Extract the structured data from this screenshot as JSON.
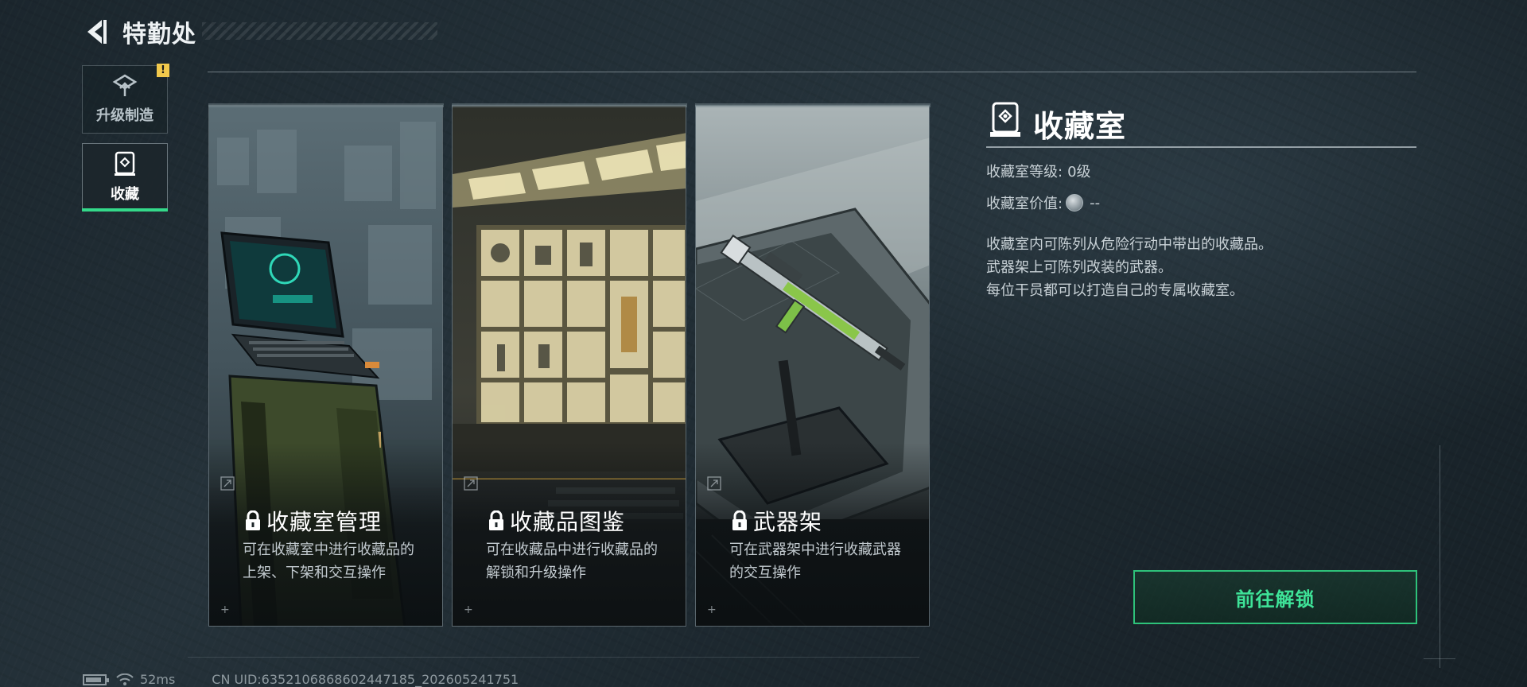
{
  "header": {
    "title": "特勤处"
  },
  "sidebar": {
    "items": [
      {
        "label": "升级制造",
        "icon": "upgrade-icon",
        "active": false,
        "badge": "!"
      },
      {
        "label": "收藏",
        "icon": "collection-icon",
        "active": true
      }
    ]
  },
  "cards": [
    {
      "title": "收藏室管理",
      "desc_line1": "可在收藏室中进行收藏品的",
      "desc_line2": "上架、下架和交互操作",
      "icon": "lock-icon"
    },
    {
      "title": "收藏品图鉴",
      "desc_line1": "可在收藏品中进行收藏品的",
      "desc_line2": "解锁和升级操作",
      "icon": "lock-icon"
    },
    {
      "title": "武器架",
      "desc_line1": "可在武器架中进行收藏武器",
      "desc_line2": "的交互操作",
      "icon": "lock-icon"
    }
  ],
  "info": {
    "title": "收藏室",
    "level_label": "收藏室等级:",
    "level_value": "0级",
    "value_label": "收藏室价值:",
    "value_value": "--",
    "desc_lines": [
      "收藏室内可陈列从危险行动中带出的收藏品。",
      "武器架上可陈列改装的武器。",
      "每位干员都可以打造自己的专属收藏室。"
    ],
    "button_label": "前往解锁"
  },
  "footer": {
    "ping": "52ms",
    "uid": "CN UID:6352106868602447185_202605241751"
  },
  "colors": {
    "accent_green": "#34d98a",
    "button_text": "#3ee398",
    "badge_yellow": "#f2c94c"
  }
}
